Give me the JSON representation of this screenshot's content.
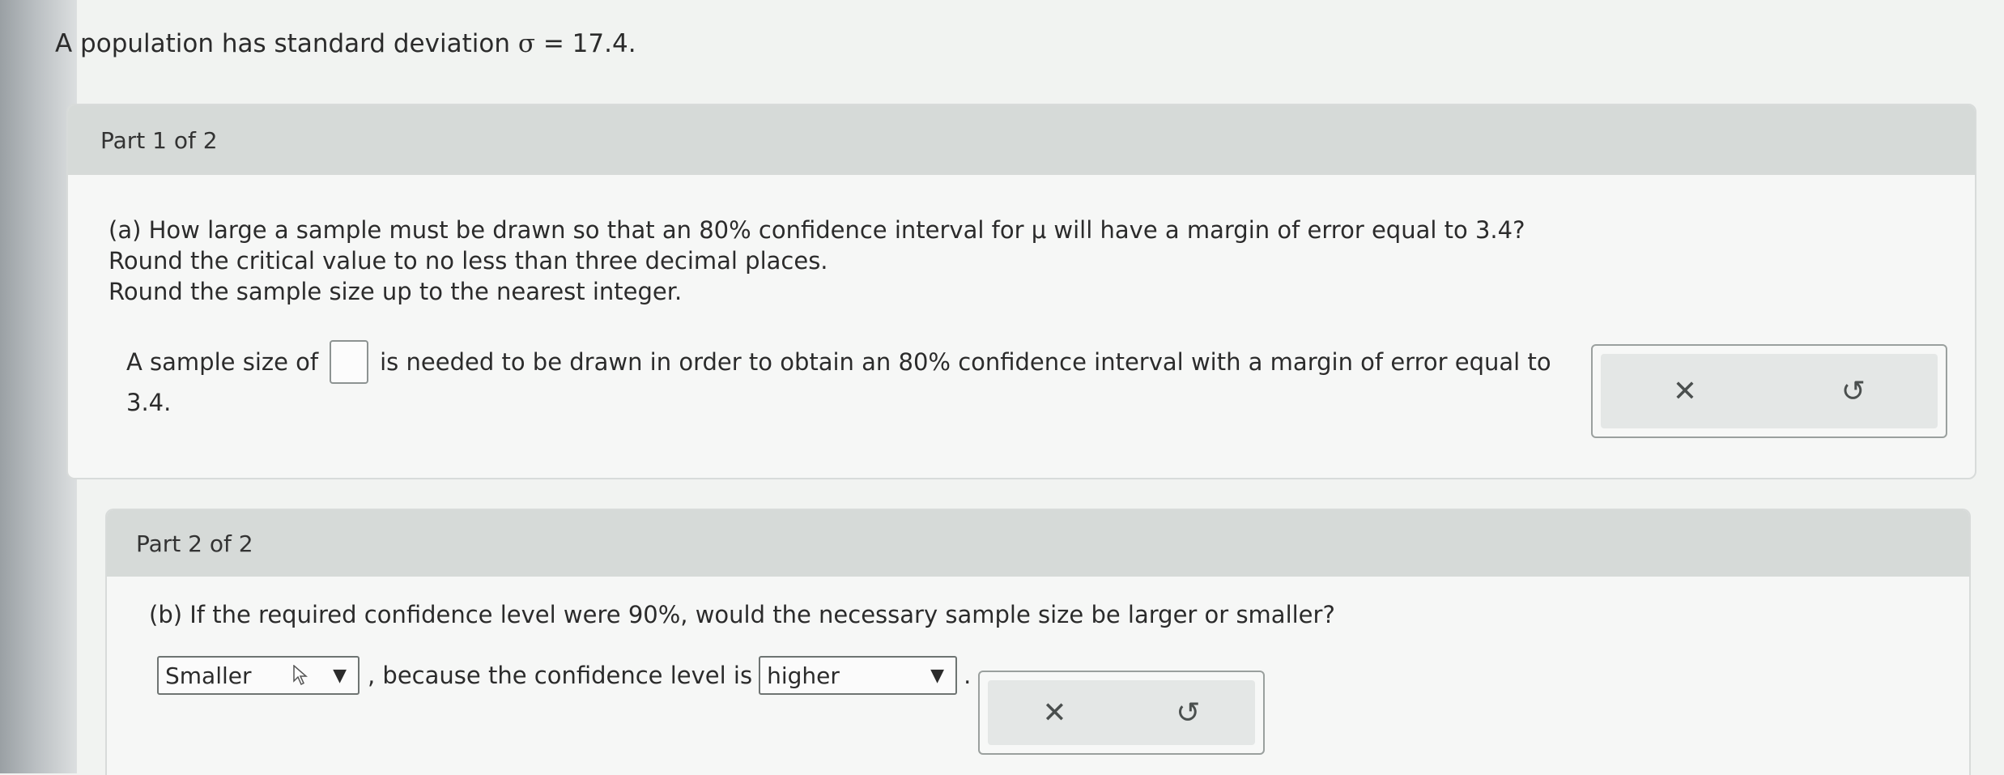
{
  "intro": {
    "text_prefix": "A population has standard deviation ",
    "sigma_symbol": "σ",
    "text_suffix": " = 17.4."
  },
  "part1": {
    "header": "Part 1 of 2",
    "question_line1": "(a) How large a sample must be drawn so that an 80% confidence interval for μ will have a margin of error equal to 3.4?",
    "question_line2": "Round the critical value to no less than three decimal places.",
    "question_line3": "Round the sample size up to the nearest integer.",
    "answer_prefix": "A sample size of",
    "answer_value": "",
    "answer_suffix": "is needed to be drawn in order to obtain an 80% confidence interval with a margin of error equal to",
    "answer_end": "3.4.",
    "clear_symbol": "✕",
    "undo_symbol": "↺"
  },
  "part2": {
    "header": "Part 2 of 2",
    "question": "(b) If the required confidence level were 90%, would the necessary sample size be larger or smaller?",
    "dropdown1_value": "Smaller",
    "middle_text": ", because the confidence level is",
    "dropdown2_value": "higher",
    "end_text": ".",
    "caret_symbol": "▼",
    "clear_symbol": "✕",
    "undo_symbol": "↺"
  }
}
